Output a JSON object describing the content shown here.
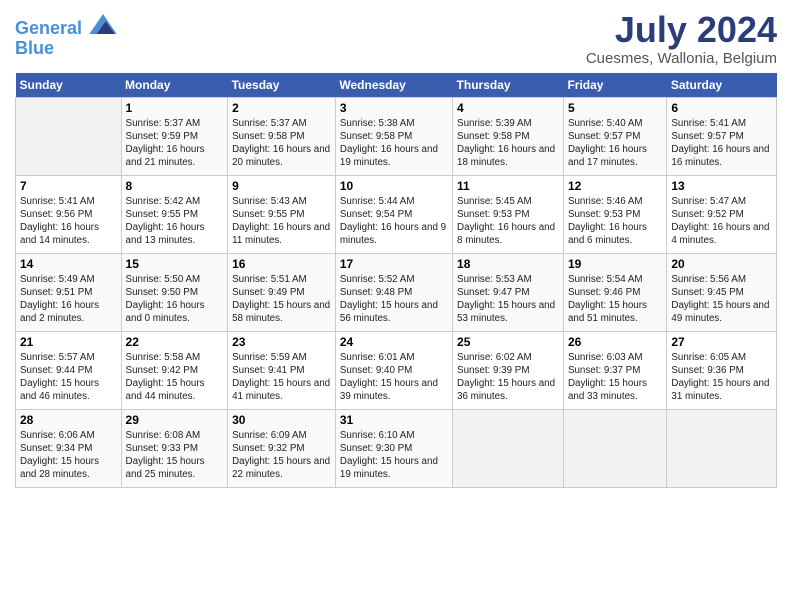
{
  "header": {
    "logo_line1": "General",
    "logo_line2": "Blue",
    "title": "July 2024",
    "subtitle": "Cuesmes, Wallonia, Belgium"
  },
  "calendar": {
    "weekdays": [
      "Sunday",
      "Monday",
      "Tuesday",
      "Wednesday",
      "Thursday",
      "Friday",
      "Saturday"
    ],
    "weeks": [
      [
        {
          "day": "",
          "sunrise": "",
          "sunset": "",
          "daylight": ""
        },
        {
          "day": "1",
          "sunrise": "Sunrise: 5:37 AM",
          "sunset": "Sunset: 9:59 PM",
          "daylight": "Daylight: 16 hours and 21 minutes."
        },
        {
          "day": "2",
          "sunrise": "Sunrise: 5:37 AM",
          "sunset": "Sunset: 9:58 PM",
          "daylight": "Daylight: 16 hours and 20 minutes."
        },
        {
          "day": "3",
          "sunrise": "Sunrise: 5:38 AM",
          "sunset": "Sunset: 9:58 PM",
          "daylight": "Daylight: 16 hours and 19 minutes."
        },
        {
          "day": "4",
          "sunrise": "Sunrise: 5:39 AM",
          "sunset": "Sunset: 9:58 PM",
          "daylight": "Daylight: 16 hours and 18 minutes."
        },
        {
          "day": "5",
          "sunrise": "Sunrise: 5:40 AM",
          "sunset": "Sunset: 9:57 PM",
          "daylight": "Daylight: 16 hours and 17 minutes."
        },
        {
          "day": "6",
          "sunrise": "Sunrise: 5:41 AM",
          "sunset": "Sunset: 9:57 PM",
          "daylight": "Daylight: 16 hours and 16 minutes."
        }
      ],
      [
        {
          "day": "7",
          "sunrise": "Sunrise: 5:41 AM",
          "sunset": "Sunset: 9:56 PM",
          "daylight": "Daylight: 16 hours and 14 minutes."
        },
        {
          "day": "8",
          "sunrise": "Sunrise: 5:42 AM",
          "sunset": "Sunset: 9:55 PM",
          "daylight": "Daylight: 16 hours and 13 minutes."
        },
        {
          "day": "9",
          "sunrise": "Sunrise: 5:43 AM",
          "sunset": "Sunset: 9:55 PM",
          "daylight": "Daylight: 16 hours and 11 minutes."
        },
        {
          "day": "10",
          "sunrise": "Sunrise: 5:44 AM",
          "sunset": "Sunset: 9:54 PM",
          "daylight": "Daylight: 16 hours and 9 minutes."
        },
        {
          "day": "11",
          "sunrise": "Sunrise: 5:45 AM",
          "sunset": "Sunset: 9:53 PM",
          "daylight": "Daylight: 16 hours and 8 minutes."
        },
        {
          "day": "12",
          "sunrise": "Sunrise: 5:46 AM",
          "sunset": "Sunset: 9:53 PM",
          "daylight": "Daylight: 16 hours and 6 minutes."
        },
        {
          "day": "13",
          "sunrise": "Sunrise: 5:47 AM",
          "sunset": "Sunset: 9:52 PM",
          "daylight": "Daylight: 16 hours and 4 minutes."
        }
      ],
      [
        {
          "day": "14",
          "sunrise": "Sunrise: 5:49 AM",
          "sunset": "Sunset: 9:51 PM",
          "daylight": "Daylight: 16 hours and 2 minutes."
        },
        {
          "day": "15",
          "sunrise": "Sunrise: 5:50 AM",
          "sunset": "Sunset: 9:50 PM",
          "daylight": "Daylight: 16 hours and 0 minutes."
        },
        {
          "day": "16",
          "sunrise": "Sunrise: 5:51 AM",
          "sunset": "Sunset: 9:49 PM",
          "daylight": "Daylight: 15 hours and 58 minutes."
        },
        {
          "day": "17",
          "sunrise": "Sunrise: 5:52 AM",
          "sunset": "Sunset: 9:48 PM",
          "daylight": "Daylight: 15 hours and 56 minutes."
        },
        {
          "day": "18",
          "sunrise": "Sunrise: 5:53 AM",
          "sunset": "Sunset: 9:47 PM",
          "daylight": "Daylight: 15 hours and 53 minutes."
        },
        {
          "day": "19",
          "sunrise": "Sunrise: 5:54 AM",
          "sunset": "Sunset: 9:46 PM",
          "daylight": "Daylight: 15 hours and 51 minutes."
        },
        {
          "day": "20",
          "sunrise": "Sunrise: 5:56 AM",
          "sunset": "Sunset: 9:45 PM",
          "daylight": "Daylight: 15 hours and 49 minutes."
        }
      ],
      [
        {
          "day": "21",
          "sunrise": "Sunrise: 5:57 AM",
          "sunset": "Sunset: 9:44 PM",
          "daylight": "Daylight: 15 hours and 46 minutes."
        },
        {
          "day": "22",
          "sunrise": "Sunrise: 5:58 AM",
          "sunset": "Sunset: 9:42 PM",
          "daylight": "Daylight: 15 hours and 44 minutes."
        },
        {
          "day": "23",
          "sunrise": "Sunrise: 5:59 AM",
          "sunset": "Sunset: 9:41 PM",
          "daylight": "Daylight: 15 hours and 41 minutes."
        },
        {
          "day": "24",
          "sunrise": "Sunrise: 6:01 AM",
          "sunset": "Sunset: 9:40 PM",
          "daylight": "Daylight: 15 hours and 39 minutes."
        },
        {
          "day": "25",
          "sunrise": "Sunrise: 6:02 AM",
          "sunset": "Sunset: 9:39 PM",
          "daylight": "Daylight: 15 hours and 36 minutes."
        },
        {
          "day": "26",
          "sunrise": "Sunrise: 6:03 AM",
          "sunset": "Sunset: 9:37 PM",
          "daylight": "Daylight: 15 hours and 33 minutes."
        },
        {
          "day": "27",
          "sunrise": "Sunrise: 6:05 AM",
          "sunset": "Sunset: 9:36 PM",
          "daylight": "Daylight: 15 hours and 31 minutes."
        }
      ],
      [
        {
          "day": "28",
          "sunrise": "Sunrise: 6:06 AM",
          "sunset": "Sunset: 9:34 PM",
          "daylight": "Daylight: 15 hours and 28 minutes."
        },
        {
          "day": "29",
          "sunrise": "Sunrise: 6:08 AM",
          "sunset": "Sunset: 9:33 PM",
          "daylight": "Daylight: 15 hours and 25 minutes."
        },
        {
          "day": "30",
          "sunrise": "Sunrise: 6:09 AM",
          "sunset": "Sunset: 9:32 PM",
          "daylight": "Daylight: 15 hours and 22 minutes."
        },
        {
          "day": "31",
          "sunrise": "Sunrise: 6:10 AM",
          "sunset": "Sunset: 9:30 PM",
          "daylight": "Daylight: 15 hours and 19 minutes."
        },
        {
          "day": "",
          "sunrise": "",
          "sunset": "",
          "daylight": ""
        },
        {
          "day": "",
          "sunrise": "",
          "sunset": "",
          "daylight": ""
        },
        {
          "day": "",
          "sunrise": "",
          "sunset": "",
          "daylight": ""
        }
      ]
    ]
  }
}
